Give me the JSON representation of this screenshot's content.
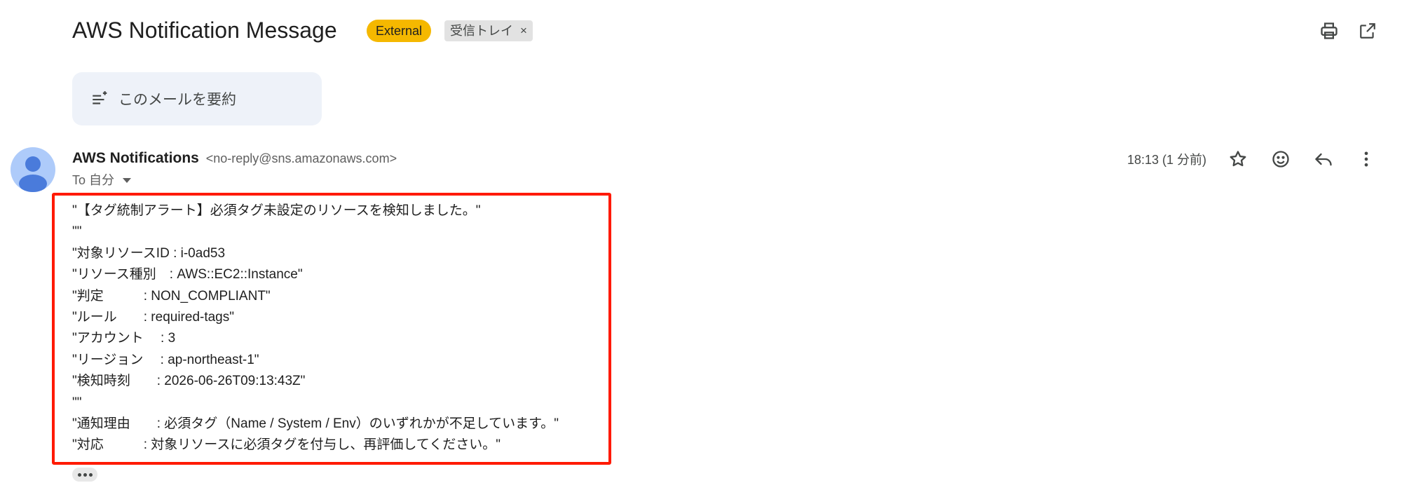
{
  "email": {
    "subject": "AWS Notification Message",
    "badge_external": "External",
    "label_inbox": "受信トレイ",
    "label_close": "×",
    "summarize_label": "このメールを要約",
    "sender_name": "AWS Notifications",
    "sender_email": "<no-reply@sns.amazonaws.com>",
    "to_label": "To 自分",
    "timestamp": "18:13 (1 分前)",
    "body_lines": [
      "\"【タグ統制アラート】必須タグ未設定のリソースを検知しました。\"",
      "\"\"",
      "\"対象リソースID : i-0ad53",
      "\"リソース種別　: AWS::EC2::Instance\"",
      "\"判定　　　: NON_COMPLIANT\"",
      "\"ルール　　: required-tags\"",
      "\"アカウント　 : 3",
      "\"リージョン　 : ap-northeast-1\"",
      "\"検知時刻　　: 2026-06-26T09:13:43Z\"",
      "\"\"",
      "\"通知理由　　: 必須タグ（Name / System / Env）のいずれかが不足しています。\"",
      "\"対応　　　: 対象リソースに必須タグを付与し、再評価してください。\""
    ]
  },
  "icons": {
    "print": "print-icon",
    "open_new_window": "open-in-new-icon",
    "summarize": "summarize-sparkle-icon",
    "avatar": "person-avatar-icon",
    "star": "star-icon",
    "emoji": "emoji-icon",
    "reply": "reply-icon",
    "more": "more-vert-icon",
    "expand": "ellipsis-icon"
  },
  "colors": {
    "external_badge": "#f5b800",
    "highlight_box": "#ff1a00",
    "summarize_bg": "#eef2f9",
    "avatar_bg": "#aecbfa",
    "avatar_fg": "#4a7bdb"
  }
}
